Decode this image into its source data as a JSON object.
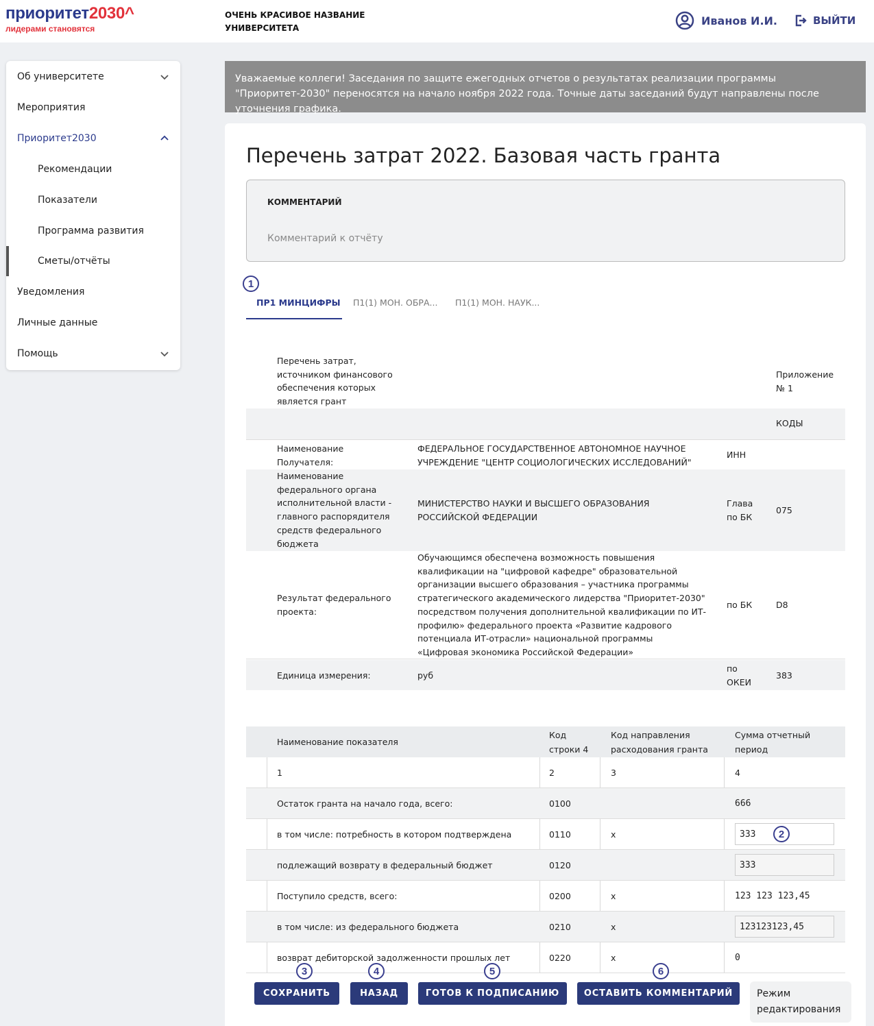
{
  "header": {
    "logo_main": "приоритет",
    "logo_year": "2030^",
    "logo_sub": "лидерами становятся",
    "university_line1": "ОЧЕНЬ КРАСИВОЕ НАЗВАНИЕ",
    "university_line2": "УНИВЕРСИТЕТА",
    "user_name": "Иванов И.И.",
    "logout_label": "ВЫЙТИ",
    "accent_color": "#2b3a8c",
    "brand_red": "#e2323b"
  },
  "sidebar": {
    "items": [
      {
        "label": "Об университете",
        "icon": "chevron-down-icon"
      },
      {
        "label": "Мероприятия"
      },
      {
        "label": "Приоритет2030",
        "icon": "chevron-up-icon",
        "active": true
      },
      {
        "label": "Рекомендации"
      },
      {
        "label": "Показатели"
      },
      {
        "label": "Программа развития"
      },
      {
        "label": "Сметы/отчёты",
        "selected": true
      },
      {
        "label": "Уведомления"
      },
      {
        "label": "Личные данные"
      },
      {
        "label": "Помощь",
        "icon": "chevron-down-icon"
      }
    ]
  },
  "notice": {
    "text": "Уважаемые коллеги! Заседания по защите ежегодных отчетов о результатах реализации программы \"Приоритет-2030\" переносятся на начало ноября 2022 года. Точные даты заседаний будут направлены после уточнения графика."
  },
  "main": {
    "title": "Перечень затрат 2022. Базовая часть гранта",
    "comment_label": "КОММЕНТАРИЙ",
    "comment_placeholder": "Комментарий к отчёту",
    "tabs": [
      {
        "label": "ПР1 МИНЦИФРЫ",
        "active": true
      },
      {
        "label": "П1(1) МОН. ОБРА..."
      },
      {
        "label": "П1(1) МОН. НАУК..."
      }
    ],
    "badges": [
      "1",
      "2",
      "3",
      "4",
      "5",
      "6"
    ]
  },
  "info": {
    "title_line1": "Перечень затрат,",
    "title_line2": "источником финансового",
    "title_line3": "обеспечения которых",
    "title_line4": "является грант",
    "appendix_line1": "Приложение",
    "appendix_line2": "№ 1",
    "codes_label": "КОДЫ",
    "recipient_label_1": "Наименование",
    "recipient_label_2": "Получателя:",
    "recipient_value_1": "ФЕДЕРАЛЬНОЕ ГОСУДАРСТВЕННОЕ АВТОНОМНОЕ НАУЧНОЕ",
    "recipient_value_2": "УЧРЕЖДЕНИЕ \"ЦЕНТР СОЦИОЛОГИЧЕСКИХ ИССЛЕДОВАНИЙ\"",
    "inn_label": "ИНН",
    "organ_label": [
      "Наименование",
      "федерального органа",
      "исполнительной власти -",
      "главного распорядителя",
      "средств федерального",
      "бюджета"
    ],
    "organ_value_1": "МИНИСТЕРСТВО НАУКИ И ВЫСШЕГО ОБРАЗОВАНИЯ",
    "organ_value_2": "РОССИЙСКОЙ ФЕДЕРАЦИИ",
    "glava_label_1": "Глава",
    "glava_label_2": "по БК",
    "glava_code": "075",
    "result_label_1": "Результат федерального",
    "result_label_2": "проекта:",
    "result_value": [
      "Обучающимся обеспечена возможность повышения",
      "квалификации на \"цифровой кафедре\" образовательной",
      "организации высшего образования – участника программы",
      "стратегического академического лидерства \"Приоритет-2030\"",
      "посредством получения дополнительной квалификации по ИТ-",
      "профилю» федерального проекта «Развитие кадрового",
      "потенциала ИТ-отрасли» национальной программы",
      "«Цифровая экономика Российской Федерации»"
    ],
    "result_bk_label": "по БК",
    "result_code": "D8",
    "unit_label": "Единица измерения:",
    "unit_value": "руб",
    "okei_label_1": "по",
    "okei_label_2": "ОКЕИ",
    "okei_code": "383"
  },
  "table": {
    "headers": {
      "name": "Наименование показателя",
      "code_1": "Код",
      "code_2": "строки 4",
      "dir_1": "Код направления",
      "dir_2": "расходования гранта",
      "sum_1": "Сумма отчетный",
      "sum_2": "период"
    },
    "rows": [
      {
        "name": "1",
        "code": "2",
        "dir": "3",
        "sum": "4"
      },
      {
        "name": "Остаток гранта на начало года, всего:",
        "code": "0100",
        "dir": "",
        "sum": "666"
      },
      {
        "name": "в том числе: потребность в котором подтверждена",
        "code": "0110",
        "dir": "х",
        "sum": "333"
      },
      {
        "name": "подлежащий возврату в федеральный бюджет",
        "code": "0120",
        "dir": "",
        "sum": "333"
      },
      {
        "name": "Поступило средств, всего:",
        "code": "0200",
        "dir": "х",
        "sum": "123 123 123,45"
      },
      {
        "name": "в том числе: из федерального бюджета",
        "code": "0210",
        "dir": "х",
        "sum": "123123123,45"
      },
      {
        "name": "возврат дебиторской задолженности прошлых лет",
        "code": "0220",
        "dir": "х",
        "sum": "0"
      }
    ]
  },
  "actions": {
    "save": "СОХРАНИТЬ",
    "back": "НАЗАД",
    "ready": "ГОТОВ К ПОДПИСАНИЮ",
    "comment": "ОСТАВИТЬ КОММЕНТАРИЙ",
    "edit_mode_1": "Режим",
    "edit_mode_2": "редактирования"
  }
}
